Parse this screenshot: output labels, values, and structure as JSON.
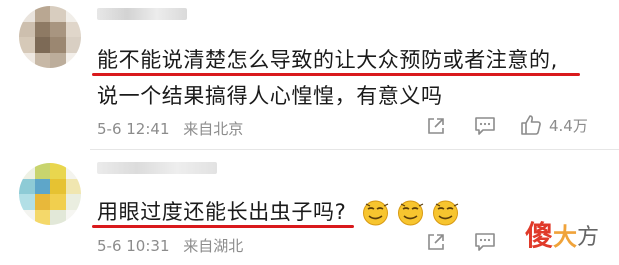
{
  "comments": [
    {
      "text_line1": "能不能说清楚怎么导致的让大众预防或者注意的,",
      "text_line2": "说一个结果搞得人心惶惶，有意义吗",
      "date": "5-6 12:41",
      "source": "来自北京",
      "like_count": "4.4万"
    },
    {
      "text_line1": "用眼过度还能长出虫子吗?",
      "date": "5-6 10:31",
      "source": "来自湖北"
    }
  ],
  "watermark": {
    "char1": "傻",
    "char2": "大",
    "char3": "方"
  },
  "colors": {
    "underline": "#d9191c",
    "meta": "#8c8c8c",
    "watermark_red": "#e03a2a",
    "watermark_orange": "#f0a33a"
  },
  "icons": [
    "share-icon",
    "comment-icon",
    "like-icon",
    "smirk-emoji-icon"
  ]
}
